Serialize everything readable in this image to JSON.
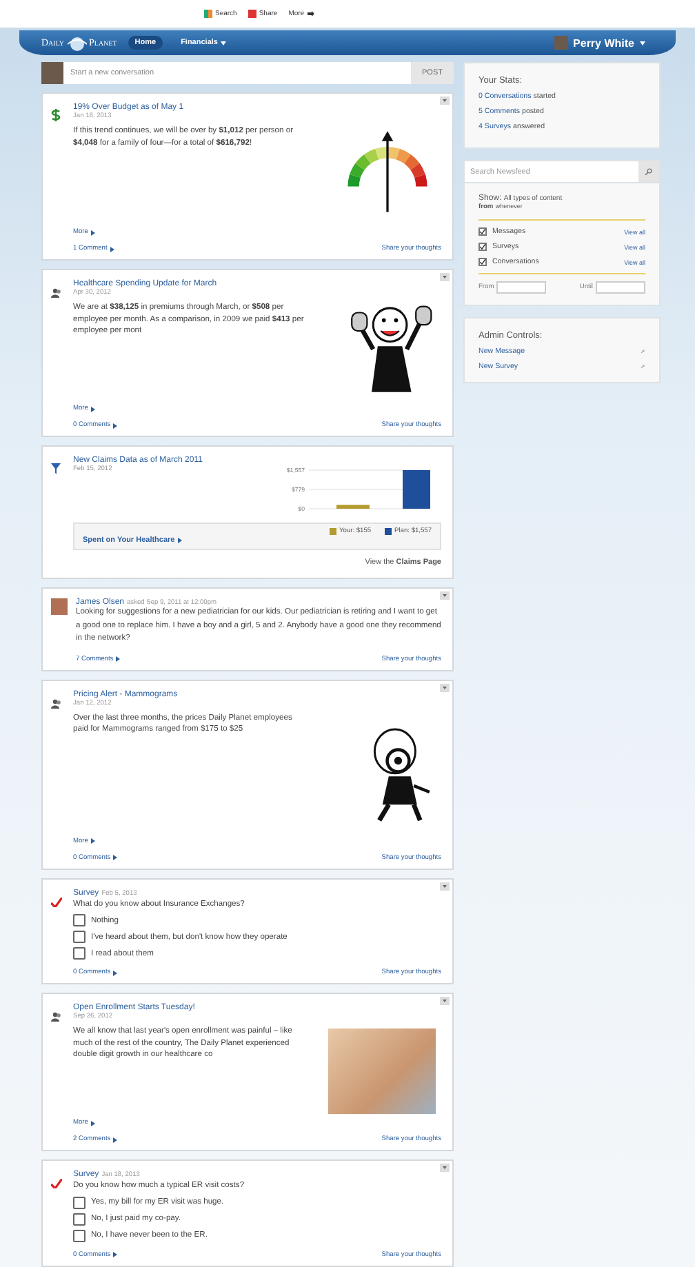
{
  "toolbar": {
    "items": [
      {
        "label": "Search"
      },
      {
        "label": "Share"
      },
      {
        "label": "More"
      }
    ]
  },
  "header": {
    "logo": [
      "Daily",
      "Planet"
    ],
    "nav": [
      {
        "label": "Home",
        "selected": true,
        "dropdown": false
      },
      {
        "label": "Financials",
        "selected": false,
        "dropdown": true
      }
    ],
    "user": "Perry White"
  },
  "composer": {
    "placeholder": "Start a new conversation",
    "button": "POST"
  },
  "feed": [
    {
      "kind": "article",
      "title": "19% Over Budget as of May 1",
      "date": "Jan 18, 2013",
      "body": "If this trend continues, we will be over by **$1,012** per person or **$4,048** for a family of four—for a total of **$616,792**!",
      "more": "More",
      "comments": "1 Comment",
      "share": "Share your thoughts"
    },
    {
      "kind": "article",
      "title": "Healthcare Spending Update for March",
      "date": "Apr 30, 2012",
      "body": "We are at **$38,125** in premiums through March, or **$508** per employee per month. As a comparison, in 2009 we paid **$413** per employee per mont",
      "more": "More",
      "comments": "0 Comments",
      "share": "Share your thoughts"
    },
    {
      "kind": "chart",
      "title": "New Claims Data as of March 2011",
      "date": "Feb 15, 2012",
      "chart_data": {
        "type": "bar",
        "series": [
          {
            "name": "Your: $155",
            "color": "#b59a2e",
            "values": [
              155,
              null
            ]
          },
          {
            "name": "Plan: $1,557",
            "color": "#1f4e9a",
            "values": [
              null,
              1557
            ]
          }
        ],
        "ylim": [
          0,
          1557
        ],
        "yticks": [
          {
            "value": 0,
            "label": "$0"
          },
          {
            "value": 779,
            "label": "$779"
          },
          {
            "value": 1557,
            "label": "$1,557"
          }
        ]
      },
      "link": "Spent on Your Healthcare",
      "footer": "View the **Claims Page**"
    },
    {
      "kind": "post",
      "author": "James Olsen",
      "meta": "asked Sep 9, 2011 at 12:00pm",
      "body": "Looking for suggestions for a new pediatrician for our kids. Our pediatrician is retiring and I want to get a good one to replace him. I have a boy and a girl, 5 and 2. Anybody have a good one they recommend in the network?",
      "comments": "7 Comments",
      "share": "Share your thoughts"
    },
    {
      "kind": "article",
      "title": "Pricing Alert - Mammograms",
      "date": "Jan 12, 2012",
      "body": "Over the last three months, the prices Daily Planet employees paid for Mammograms ranged from $175 to $25",
      "more": "More",
      "comments": "0 Comments",
      "share": "Share your thoughts"
    },
    {
      "kind": "survey",
      "title": "Survey",
      "date": "Feb 5, 2013",
      "question": "What do you know about Insurance Exchanges?",
      "options": [
        {
          "label": "Nothing",
          "checked": false
        },
        {
          "label": "I've heard about them, but don't know how they operate",
          "checked": false
        },
        {
          "label": "I read about them",
          "checked": false
        }
      ],
      "comments": "0 Comments",
      "share": "Share your thoughts"
    },
    {
      "kind": "article",
      "title": "Open Enrollment Starts Tuesday!",
      "date": "Sep 26, 2012",
      "body": "We all know that last year's open enrollment was painful – like much of the rest of the country, The Daily Planet experienced double digit growth in our healthcare co",
      "more": "More",
      "comments": "2 Comments",
      "share": "Share your thoughts"
    },
    {
      "kind": "survey",
      "title": "Survey",
      "date": "Jan 18, 2013",
      "question": "Do you know how much a typical ER visit costs?",
      "options": [
        {
          "label": "Yes, my bill for my ER visit was huge.",
          "checked": false
        },
        {
          "label": "No, I just paid my co-pay.",
          "checked": false
        },
        {
          "label": "No, I have never been to the ER.",
          "checked": false
        }
      ],
      "comments": "0 Comments",
      "share": "Share your thoughts"
    }
  ],
  "sidebar": {
    "stats": {
      "title": "Your Stats:",
      "items": [
        {
          "link": "0 Conversations",
          "text": "started"
        },
        {
          "link": "5 Comments",
          "text": "posted"
        },
        {
          "link": "4 Surveys",
          "text": "answered"
        }
      ]
    },
    "search": {
      "placeholder": "Search Newsfeed"
    },
    "show": {
      "label": "Show:",
      "value": "All types of content",
      "from_label": "from",
      "from_value": "whenever"
    },
    "filters": [
      {
        "label": "Messages",
        "checked": true,
        "link": "View all"
      },
      {
        "label": "Surveys",
        "checked": true,
        "link": "View all"
      },
      {
        "label": "Conversations",
        "checked": true,
        "link": "View all"
      }
    ],
    "range": {
      "from": "From",
      "until": "Until"
    },
    "admin": {
      "title": "Admin Controls:",
      "items": [
        "New Message",
        "New Survey"
      ]
    }
  }
}
